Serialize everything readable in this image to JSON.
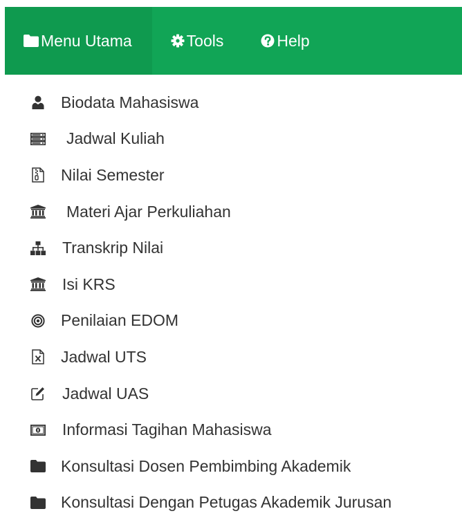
{
  "topnav": {
    "background_color": "#11a556",
    "active_background_color": "#0f9a4f",
    "text_color": "#ffffff",
    "tabs": [
      {
        "label": "Menu Utama",
        "icon": "folder-icon",
        "active": true
      },
      {
        "label": "Tools",
        "icon": "cog-icon",
        "active": false
      },
      {
        "label": "Help",
        "icon": "question-circle-icon",
        "active": false
      }
    ]
  },
  "menu": {
    "text_color": "#333333",
    "icon_color": "#333333",
    "items": [
      {
        "label": "Biodata Mahasiswa",
        "icon": "user-icon"
      },
      {
        "label": "Jadwal Kuliah",
        "icon": "server-icon"
      },
      {
        "label": "Nilai Semester",
        "icon": "file-zipper-icon"
      },
      {
        "label": "Materi Ajar Perkuliahan",
        "icon": "bank-icon"
      },
      {
        "label": "Transkrip Nilai",
        "icon": "sitemap-icon"
      },
      {
        "label": "Isi KRS",
        "icon": "bank-icon"
      },
      {
        "label": "Penilaian EDOM",
        "icon": "bullseye-icon"
      },
      {
        "label": "Jadwal UTS",
        "icon": "file-excel-icon"
      },
      {
        "label": "Jadwal UAS",
        "icon": "edit-icon"
      },
      {
        "label": "Informasi Tagihan Mahasiswa",
        "icon": "money-icon"
      },
      {
        "label": "Konsultasi Dosen Pembimbing Akademik",
        "icon": "folder-icon"
      },
      {
        "label": "Konsultasi Dengan Petugas Akademik Jurusan",
        "icon": "folder-icon"
      }
    ]
  }
}
